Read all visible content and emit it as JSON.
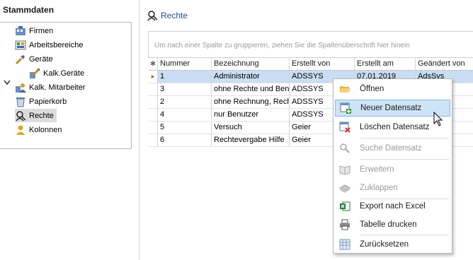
{
  "left": {
    "title": "Stammdaten",
    "items": [
      {
        "label": "Firmen",
        "icon": "company-icon"
      },
      {
        "label": "Arbeitsbereiche",
        "icon": "workspace-icon"
      },
      {
        "label": "Geräte",
        "icon": "tools-icon"
      },
      {
        "label": "Kalk.Geräte",
        "icon": "calc-device-icon"
      },
      {
        "label": "Kalk. Mitarbeiter",
        "icon": "calc-employee-icon"
      },
      {
        "label": "Papierkorb",
        "icon": "trash-icon"
      },
      {
        "label": "Rechte",
        "icon": "rights-icon"
      },
      {
        "label": "Kolonnen",
        "icon": "column-group-icon"
      }
    ],
    "selected": "Rechte"
  },
  "main": {
    "title": "Rechte",
    "group_hint": "Um nach einer Spalte zu gruppieren, ziehen Sie die Spaltenüberschrift hier hinein",
    "columns": [
      "Nummer",
      "Bezeichnung",
      "Erstellt von",
      "Erstellt am",
      "Geändert von"
    ],
    "rows": [
      [
        "1",
        "Administrator",
        "ADSSYS",
        "07.01.2019",
        "AdsSys"
      ],
      [
        "3",
        "ohne Rechte und Benutzer",
        "ADSSYS",
        "",
        ""
      ],
      [
        "2",
        "ohne Rechnung, Rechte",
        "ADSSYS",
        "",
        ""
      ],
      [
        "4",
        "nur Benutzer",
        "ADSSYS",
        "",
        ""
      ],
      [
        "5",
        "Versuch",
        "Geier",
        "",
        ""
      ],
      [
        "6",
        "Rechtevergabe Hilfe",
        "Geier",
        "",
        ""
      ]
    ]
  },
  "context_menu": {
    "items": [
      {
        "label": "Öffnen",
        "icon": "folder-open-icon",
        "enabled": true
      },
      {
        "label": "Neuer Datensatz",
        "icon": "new-record-icon",
        "enabled": true,
        "hover": true
      },
      {
        "label": "Löschen Datensatz",
        "icon": "delete-record-icon",
        "enabled": true
      },
      {
        "label": "Suche Datensatz",
        "icon": "search-icon",
        "enabled": false
      },
      {
        "label": "Erweitern",
        "icon": "expand-icon",
        "enabled": false
      },
      {
        "label": "Zuklappen",
        "icon": "collapse-icon",
        "enabled": false
      },
      {
        "label": "Export nach Excel",
        "icon": "excel-icon",
        "enabled": true
      },
      {
        "label": "Tabelle drucken",
        "icon": "printer-icon",
        "enabled": true
      },
      {
        "label": "Zurücksetzen",
        "icon": "reset-icon",
        "enabled": true
      }
    ]
  },
  "colors": {
    "accent": "#1f4e8c",
    "selection": "#c9ddf4",
    "menu_hover": "#cde3f7"
  }
}
